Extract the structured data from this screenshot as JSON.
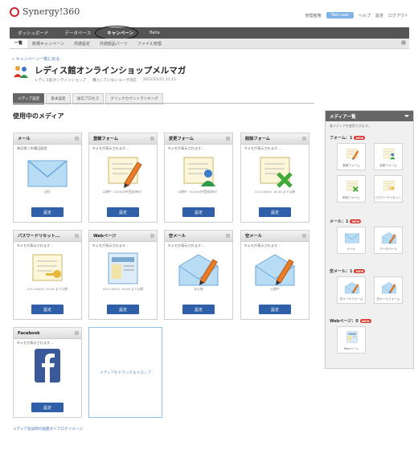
{
  "app": {
    "logo": "Synergy!360"
  },
  "user_area": {
    "role": "管理者権",
    "user": "Test user",
    "help": "ヘルプ",
    "settings": "設定",
    "logout": "ログアウト"
  },
  "main_nav": [
    "ダッシュボード",
    "データベース",
    "キャンペーン",
    "Beta"
  ],
  "sub_nav": [
    "一覧",
    "新規キャンペーン",
    "共通設定",
    "共通部品パーツ",
    "ファイル管理"
  ],
  "back_link": "« キャンペーン一覧に戻る",
  "campaign": {
    "title": "レディス館オンラインショップメルマガ",
    "meta": [
      "レディス館オンラインショップ",
      "購入していないユーザ対応",
      "2011/11/11 11:11"
    ]
  },
  "tabs": [
    "メディア設定",
    "基本設定",
    "送信プロセス",
    "クリックカウントランキング"
  ],
  "section_title": "使用中のメディア",
  "cards": [
    {
      "title": "メール",
      "note": "毎月第二木曜日配信",
      "status": "送信",
      "button": "設定",
      "icon": "envelope-icon"
    },
    {
      "title": "登録フォーム",
      "note": "※メモが表示されます…",
      "status": "公開中（0/2000件登録済み）",
      "button": "設定",
      "icon": "form-pencil-icon"
    },
    {
      "title": "変更フォーム",
      "note": "※メモが表示されます…",
      "status": "公開中（0/2000件登録済み）",
      "button": "設定",
      "icon": "form-user-icon"
    },
    {
      "title": "削除フォーム",
      "note": "※メモが表示されます…",
      "status": "2011/06/01 18:48 まで公開",
      "button": "設定",
      "icon": "form-delete-icon"
    },
    {
      "title": "パスワードリセット...",
      "note": "※メモが表示されます…",
      "status": "2011/06/01 18:48 まで公開",
      "button": "設定",
      "icon": "form-key-icon"
    },
    {
      "title": "Webページ",
      "note": "※メモが表示されます…",
      "status": "2011/06/01 18:48 まで公開",
      "button": "設定",
      "icon": "webpage-icon"
    },
    {
      "title": "空メール",
      "note": "※メモが表示されます…",
      "status": "未公開",
      "button": "設定",
      "icon": "open-envelope-icon"
    },
    {
      "title": "空メール",
      "note": "※メモが表示されます…",
      "status": "公開中",
      "button": "設定",
      "icon": "open-envelope-icon"
    },
    {
      "title": "Facebook",
      "note": "※メモが表示されます…",
      "status": "",
      "button": "設定",
      "icon": "facebook-icon"
    }
  ],
  "dropzone": "メディアをドラッグ＆ドロップ",
  "footnote": "メディア追加時の画面ダイアログイメージ",
  "sidebar": {
    "title": "メディア一覧",
    "note": "各メディアを使用できます。",
    "categories": [
      {
        "label": "フォーム：1",
        "badge": "NEW",
        "tiles": [
          "登録フォーム",
          "変更フォーム",
          "削除フォーム",
          "パスワードリセット"
        ]
      },
      {
        "label": "メール：1",
        "badge": "NEW",
        "tiles": [
          "メール",
          "データベース"
        ]
      },
      {
        "label": "空メール：1",
        "badge": "NEW",
        "tiles": [
          "空メールフォーム",
          "空メールフォーム"
        ]
      },
      {
        "label": "Webページ：0",
        "badge": "NEW",
        "tiles": [
          "Webページ"
        ]
      }
    ]
  },
  "colors": {
    "accent": "#2e5fa8",
    "nav": "#555555",
    "badge": "#d9342b",
    "link": "#4a78b8"
  }
}
